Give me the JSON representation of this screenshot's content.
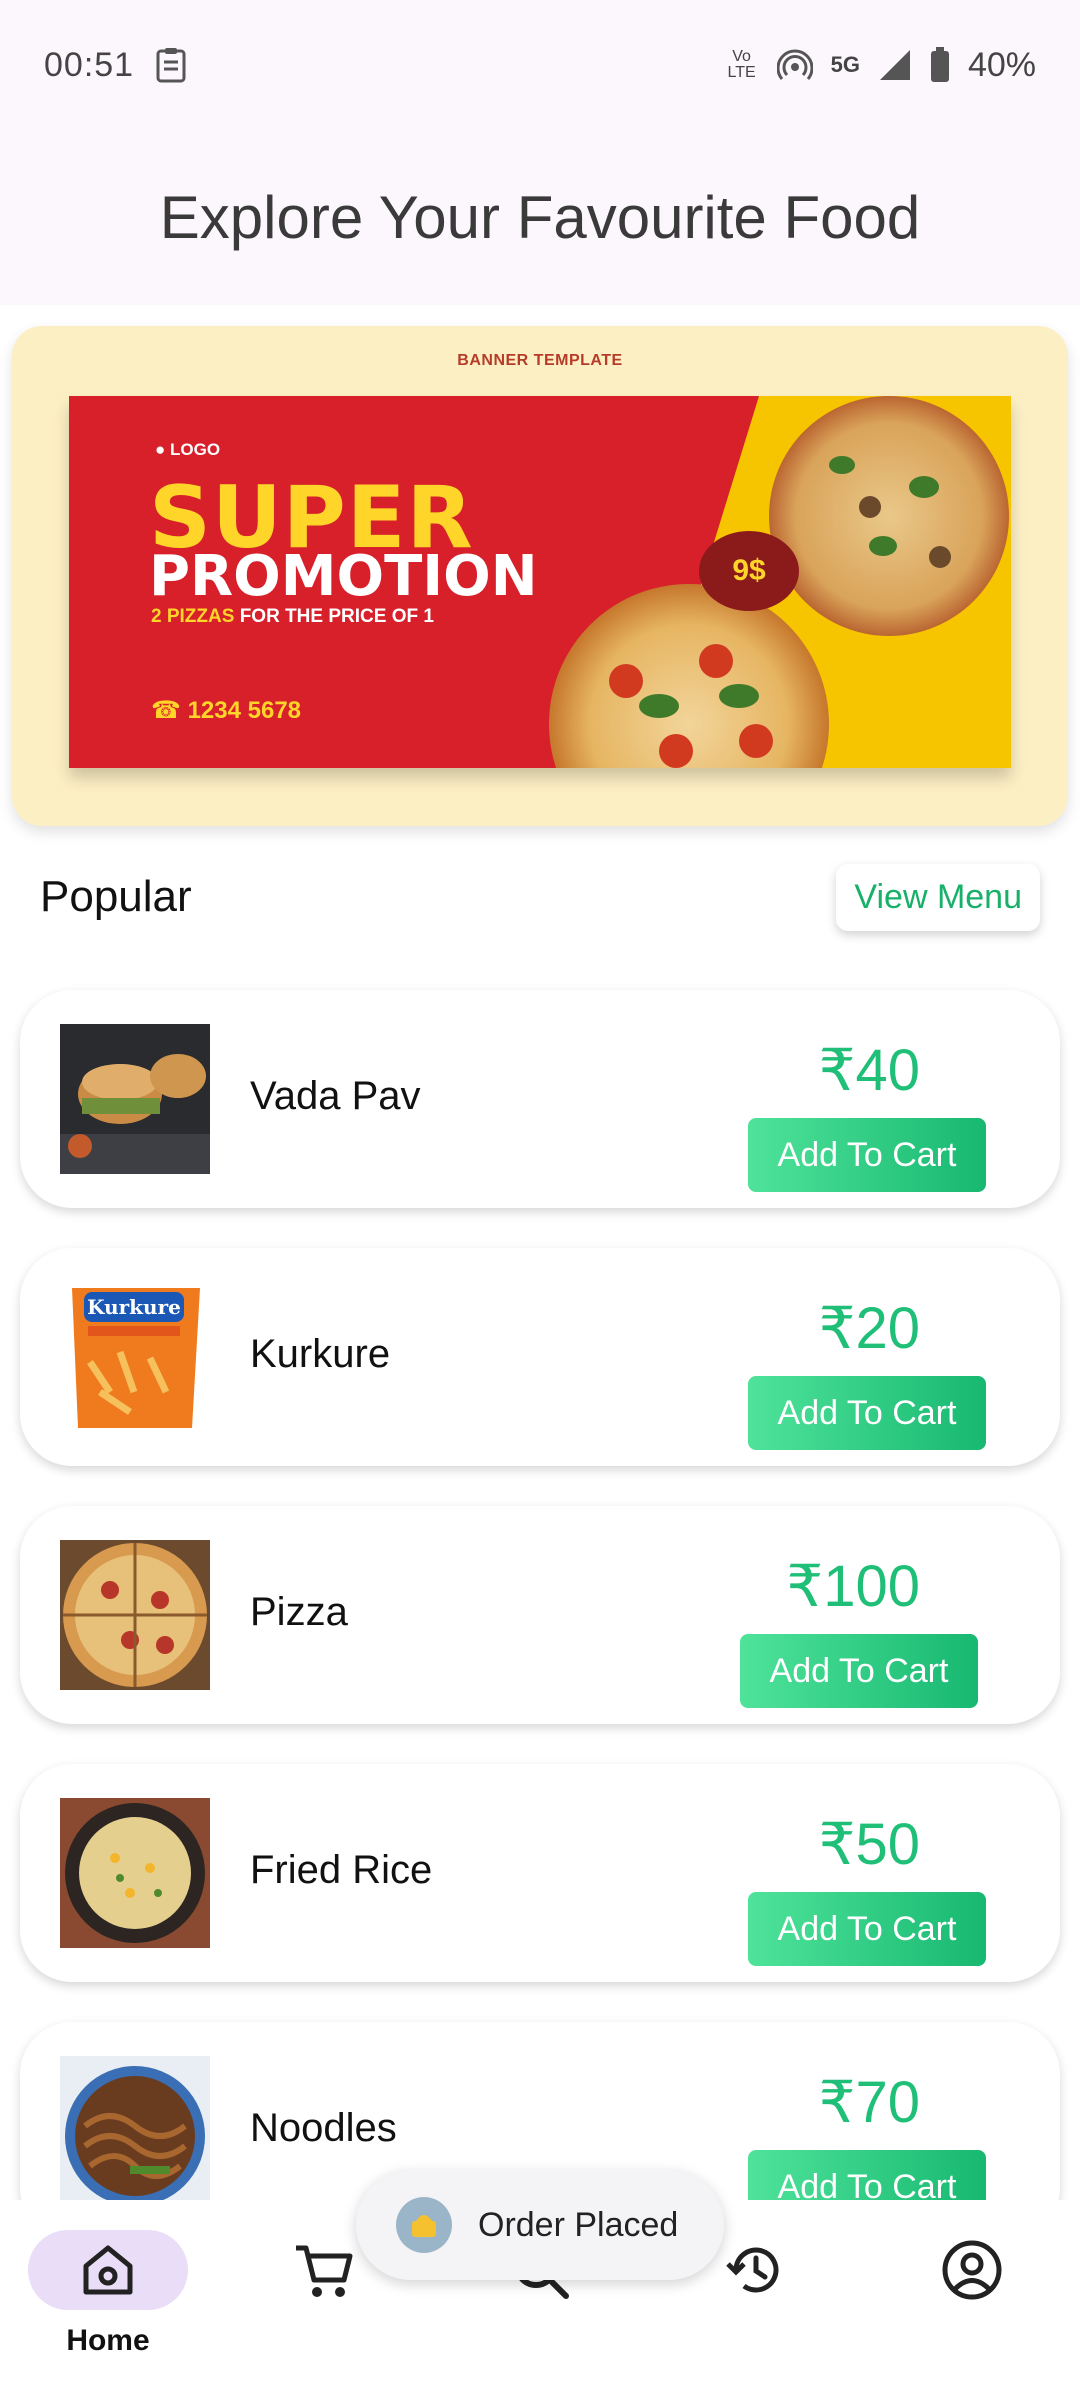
{
  "status_bar": {
    "time": "00:51",
    "network": "5G",
    "volte": "Vo LTE",
    "battery": "40%"
  },
  "header": {
    "title": "Explore Your Favourite Food"
  },
  "banner": {
    "template_label": "BANNER TEMPLATE",
    "logo_text": "LOGO",
    "headline_1": "SUPER",
    "headline_2": "PROMOTION",
    "subline_highlight": "2 PIZZAS",
    "subline_rest": "FOR THE PRICE OF 1",
    "phone": "1234 5678",
    "price_tag": "9$"
  },
  "popular": {
    "title": "Popular",
    "view_menu_label": "View Menu",
    "items": [
      {
        "name": "Vada Pav",
        "price": "₹40",
        "button": "Add To Cart"
      },
      {
        "name": "Kurkure",
        "price": "₹20",
        "button": "Add To Cart"
      },
      {
        "name": "Pizza",
        "price": "₹100",
        "button": "Add To Cart"
      },
      {
        "name": "Fried Rice",
        "price": "₹50",
        "button": "Add To Cart"
      },
      {
        "name": "Noodles",
        "price": "₹70",
        "button": "Add To Cart"
      }
    ]
  },
  "toast": {
    "message": "Order Placed"
  },
  "bottom_nav": {
    "items": [
      {
        "label": "Home",
        "icon": "home-icon",
        "active": true
      },
      {
        "label": "",
        "icon": "cart-icon"
      },
      {
        "label": "",
        "icon": "search-icon"
      },
      {
        "label": "",
        "icon": "history-icon"
      },
      {
        "label": "",
        "icon": "profile-icon"
      }
    ]
  },
  "colors": {
    "accent_green": "#1fbf77",
    "nav_active": "#e9ddf7",
    "header_bg": "#fcf7fc"
  }
}
